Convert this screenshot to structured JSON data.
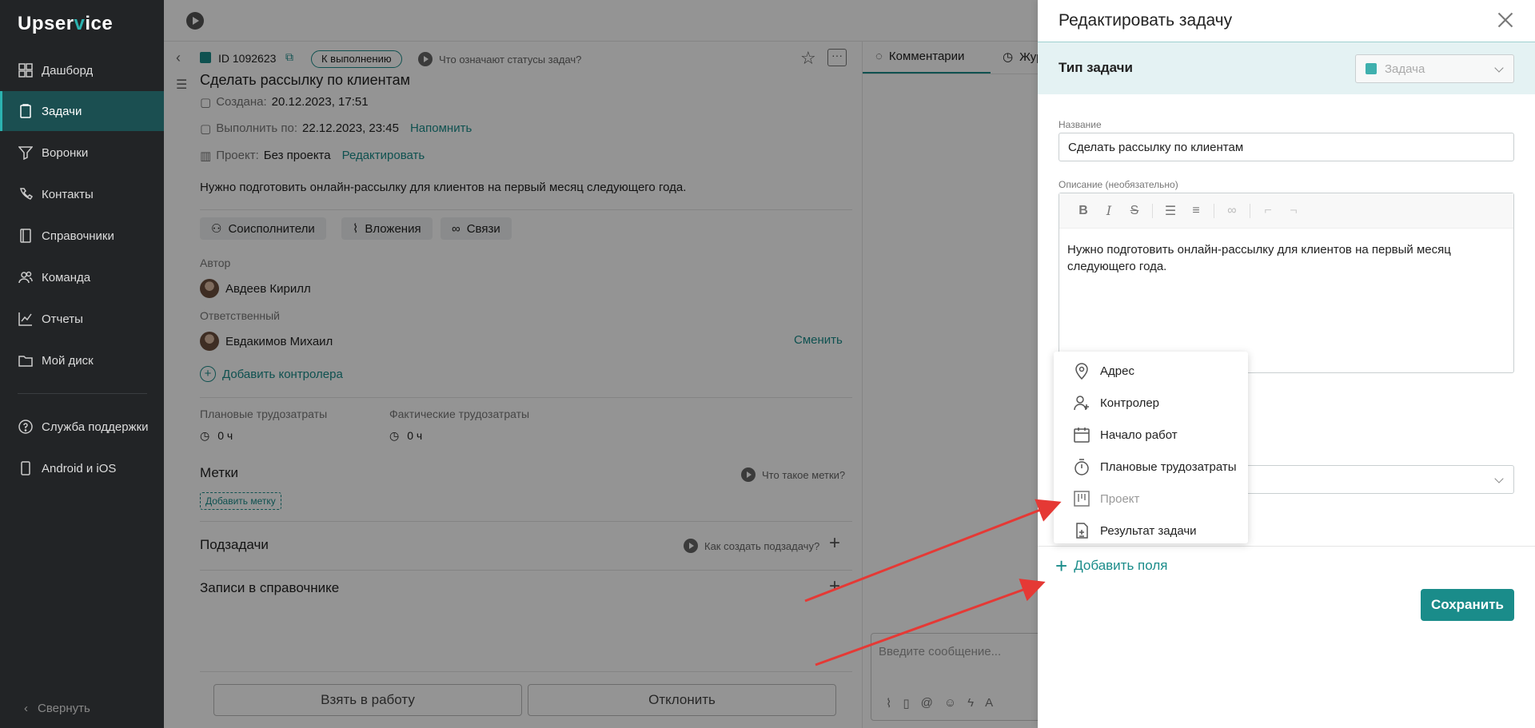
{
  "brand": {
    "name_prefix": "Upser",
    "name_v": "v",
    "name_suffix": "ice"
  },
  "sidebar": {
    "items": [
      {
        "label": "Дашборд",
        "icon": "dashboard-icon"
      },
      {
        "label": "Задачи",
        "icon": "tasks-icon",
        "active": true
      },
      {
        "label": "Воронки",
        "icon": "funnel-icon"
      },
      {
        "label": "Контакты",
        "icon": "contacts-icon"
      },
      {
        "label": "Справочники",
        "icon": "book-icon"
      },
      {
        "label": "Команда",
        "icon": "team-icon"
      },
      {
        "label": "Отчеты",
        "icon": "chart-icon"
      },
      {
        "label": "Мой диск",
        "icon": "folder-icon"
      }
    ],
    "support_label": "Служба поддержки",
    "apps_label": "Android и iOS",
    "collapse_label": "Свернуть"
  },
  "task": {
    "id": "ID 1092623",
    "status": "К выполнению",
    "status_help": "Что означают статусы задач?",
    "title": "Сделать рассылку по клиентам",
    "created_label": "Создана:",
    "created_value": "20.12.2023, 17:51",
    "due_label": "Выполнить по:",
    "due_value": "22.12.2023, 23:45",
    "remind_label": "Напомнить",
    "project_label": "Проект:",
    "project_value": "Без проекта",
    "project_edit": "Редактировать",
    "description": "Нужно подготовить онлайн-рассылку для клиентов на первый месяц следующего года.",
    "chips": [
      "Соисполнители",
      "Вложения",
      "Связи"
    ],
    "author_label": "Автор",
    "author_name": "Авдеев Кирилл",
    "assignee_label": "Ответственный",
    "assignee_name": "Евдакимов Михаил",
    "change_label": "Сменить",
    "add_controller": "Добавить контролера",
    "planned_label": "Плановые трудозатраты",
    "planned_value": "0 ч",
    "actual_label": "Фактические трудозатраты",
    "actual_value": "0 ч",
    "tags_title": "Метки",
    "tags_help": "Что такое метки?",
    "add_tag": "Добавить метку",
    "subtasks_title": "Подзадачи",
    "subtasks_help": "Как создать подзадачу?",
    "records_title": "Записи в справочнике",
    "take_button": "Взять в работу",
    "reject_button": "Отклонить"
  },
  "comments": {
    "tab_comments": "Комментарии",
    "tab_journal": "Жур",
    "message_placeholder": "Введите сообщение..."
  },
  "panel": {
    "title": "Редактировать задачу",
    "type_label": "Тип задачи",
    "type_value": "Задача",
    "name_label": "Название",
    "name_value": "Сделать рассылку по клиентам",
    "desc_label": "Описание (необязательно)",
    "desc_value": "Нужно подготовить онлайн-рассылку для клиентов на первый месяц следующего года.",
    "add_fields": "Добавить поля",
    "save": "Сохранить"
  },
  "dropdown": {
    "items": [
      {
        "label": "Адрес",
        "icon": "map-pin-icon"
      },
      {
        "label": "Контролер",
        "icon": "user-plus-icon"
      },
      {
        "label": "Начало работ",
        "icon": "calendar-icon"
      },
      {
        "label": "Плановые трудозатраты",
        "icon": "stopwatch-icon"
      },
      {
        "label": "Проект",
        "icon": "project-board-icon",
        "disabled": true
      },
      {
        "label": "Результат задачи",
        "icon": "document-result-icon"
      }
    ]
  },
  "colors": {
    "accent": "#1a8c8a",
    "sidebar_bg": "#222426",
    "active_bg": "#1b4f51",
    "arrow": "#e53935"
  }
}
